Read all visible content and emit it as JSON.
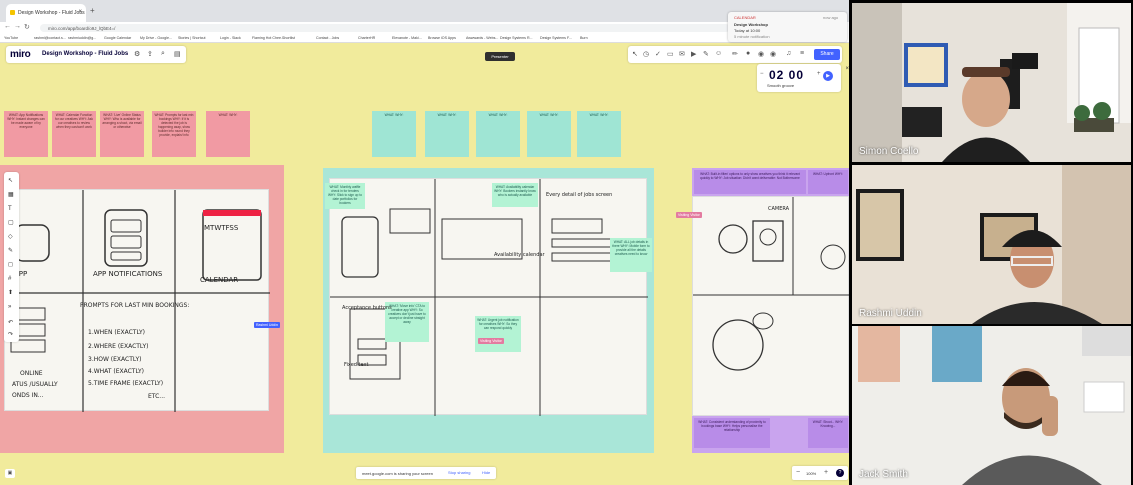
{
  "browser": {
    "tab_title": "Design Workshop - Fluid Jobs",
    "url": "miro.com/app/board/o9J_lQbE4=/",
    "bookmarks": [
      "YouTube",
      "rashmi@contact.s...",
      "rashmiuddin@g...",
      "Google Calendar",
      "My Drive - Google...",
      "Stories | Shortcut",
      "Login - Slack",
      "Flaming Hot Chee...",
      "Shortlist",
      "Contact - Jobs",
      "CharterHR",
      "Elevanote - Maki...",
      "Browse iOS Apps",
      "Awwwards - Webs...",
      "Design Systems R...",
      "Design Systems F...",
      "Burn"
    ]
  },
  "notification": {
    "app": "CALENDAR",
    "time": "now ago",
    "title": "Design Workshop",
    "subtitle": "Today at 10:00",
    "detail": "5 minute notification"
  },
  "miro": {
    "logo": "miro",
    "board_name": "Design Workshop - Fluid Jobs",
    "share_label": "Share",
    "presenter_label": "Presenter",
    "timer": "02 00",
    "timer_music": "Smooth groove",
    "zoom": "100%",
    "sharing_text": "meet.google.com is sharing your screen",
    "stop_sharing": "Stop sharing",
    "hide": "Hide"
  },
  "left_stickies": [
    {
      "text": "WHAT: App Notifications  WHY: Instant changes can be made aware of by everyone"
    },
    {
      "text": "WHAT: Calendar Function for our creatives  WHY: Ask our creatives to review when they can/can't work"
    },
    {
      "text": "WHAT: 'Live' Online Status  WHY: Who is available for arranging a shoot, via email or otherwise"
    },
    {
      "text": "WHAT: Prompts for last min bookings  WHY: If it is detected the job is happening asap, show builder info round they provide, explain/ info"
    },
    {
      "text": "WHAT:  WHY:"
    }
  ],
  "mid_stickies": [
    {
      "text": "WHAT:  WHY:"
    },
    {
      "text": "WHAT:  WHY:"
    },
    {
      "text": "WHAT:  WHY:"
    },
    {
      "text": "WHAT:  WHY:"
    },
    {
      "text": "WHAT:  WHY:"
    }
  ],
  "sketch_labels": {
    "left": [
      "APP",
      "APP NOTIFICATIONS",
      "CALENDAR",
      "MTWTFSS",
      "PROMPTS FOR LAST MIN BOOKINGS:",
      "1.WHEN (EXACTLY)",
      "2.WHERE (EXACTLY)",
      "3.HOW (EXACTLY)",
      "4.WHAT (EXACTLY)",
      "5.TIME FRAME (EXACTLY)",
      "ETC...",
      "ONLINE",
      "ATUS /USUALLY",
      "ONDS IN..."
    ],
    "mid": [
      "Every detail of jobs screen",
      "Availability calendar",
      "Acceptance buttons",
      "Fixed text"
    ],
    "right": [
      "CAMERA"
    ]
  },
  "mid_notes": [
    {
      "text": "WHAT: Monthly waffle check in for tenders  WHY: Slick to sign up to date portfolios for bookers"
    },
    {
      "text": "WHAT: Availability calendar  WHY: Bookers instantly know who is actually available"
    },
    {
      "text": "WHAT: ALL job details in there  WHY: Mobile form to provide all the details creatives need to know"
    },
    {
      "text": "WHAT: 'Move info' CTA to creative app  WHY: So creatives don't just have to accept or decline straight away"
    },
    {
      "text": "WHAT: Urgent job notification for creatives  WHY: So they can respond quickly"
    }
  ],
  "right_notes": [
    {
      "text": "WHAT: Built-in filter/ options to only show creatives you think it relevant quickly to  WHY: Job situation: Didn't want deliverable: Not Bothersome"
    },
    {
      "text": "WHAT: Upfront  WHY:"
    },
    {
      "text": "WHAT: Consistent understanding of proximity to bookings base  WHY: Helps personalise the relationship"
    },
    {
      "text": "WHAT: Shoot...  WHY: Knowing..."
    }
  ],
  "cursors": [
    "Rashmi Uddin",
    "Visiting Visitor",
    "Visiting Visitor"
  ],
  "participants": [
    {
      "name": "Simon Coello"
    },
    {
      "name": "Rashmi Uddin"
    },
    {
      "name": "Jack Smith"
    }
  ]
}
